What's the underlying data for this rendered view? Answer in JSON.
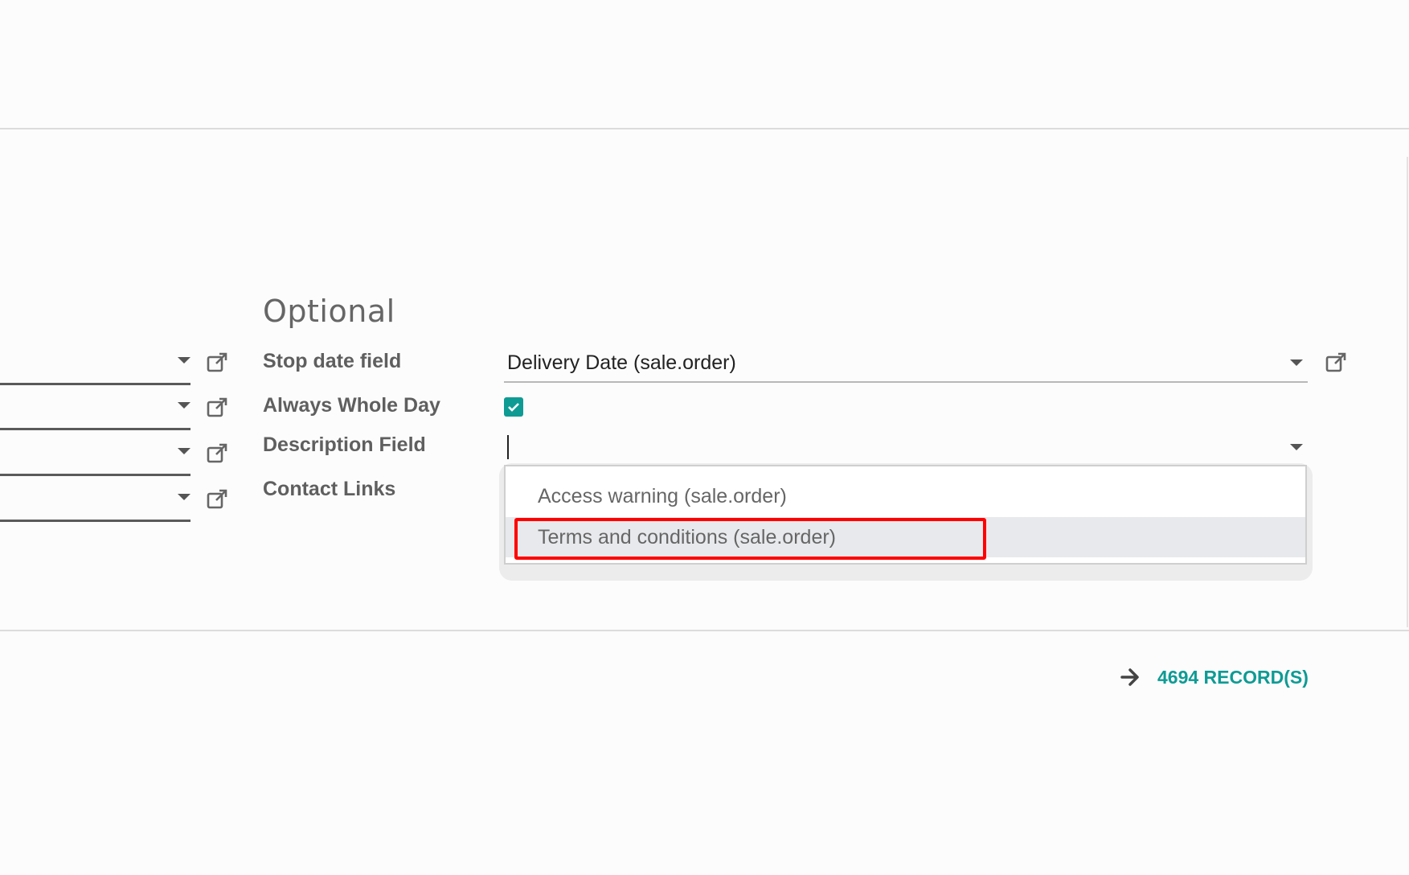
{
  "section": {
    "title": "Optional"
  },
  "fields": {
    "stop_date": {
      "label": "Stop date field",
      "value": "Delivery Date (sale.order)"
    },
    "always_whole_day": {
      "label": "Always Whole Day",
      "checked": true
    },
    "description": {
      "label": "Description Field",
      "value": ""
    },
    "contact_links": {
      "label": "Contact Links"
    }
  },
  "dropdown": {
    "options": [
      {
        "label": "Access warning (sale.order)"
      },
      {
        "label": "Terms and conditions (sale.order)"
      }
    ],
    "highlighted_index": 1
  },
  "footer": {
    "records_label": "4694 RECORD(S)"
  },
  "colors": {
    "accent": "#0e9b94",
    "records_link": "#0e9b94",
    "highlight": "#ff0000",
    "active_option_bg": "#e7e9ec"
  },
  "icons": {
    "external_link": "external-link-icon",
    "caret": "caret-down-icon",
    "arrow": "arrow-right-icon",
    "check": "checkmark-icon"
  }
}
